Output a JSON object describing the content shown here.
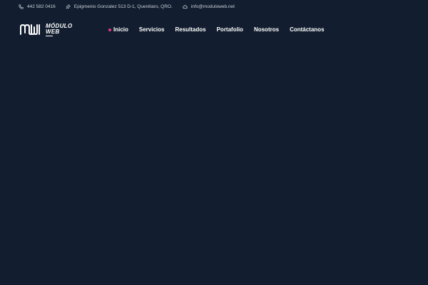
{
  "topbar": {
    "phone": {
      "icon": "phone-icon",
      "text": "442 582 0416"
    },
    "address": {
      "icon": "pin-icon",
      "text": "Epigmenio Gonzalez 513 D-1, Querétaro, QRO."
    },
    "email": {
      "icon": "cloud-icon",
      "text": "info@moduloweb.net"
    }
  },
  "logo": {
    "mark": "MW",
    "line1": "MÓDULO",
    "line2": "WEB"
  },
  "nav": {
    "items": [
      {
        "label": "Inicio",
        "active": true
      },
      {
        "label": "Servicios"
      },
      {
        "label": "Resultados"
      },
      {
        "label": "Portafolio"
      },
      {
        "label": "Nosotros"
      },
      {
        "label": "Contáctanos"
      }
    ]
  },
  "colors": {
    "background": "#121e2f",
    "text": "#ffffff",
    "muted_text": "#c9ced6",
    "active_dot": "#e8358f"
  }
}
